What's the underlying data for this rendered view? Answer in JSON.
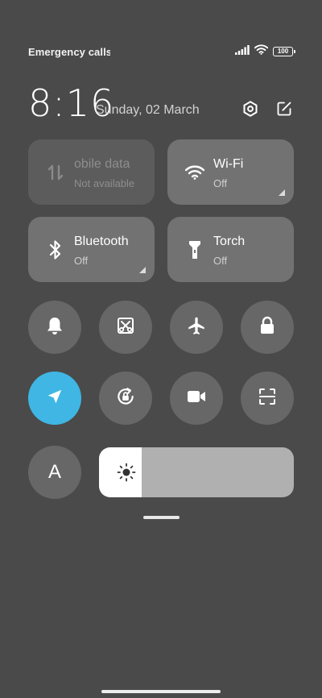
{
  "status_bar": {
    "carrier_text": "Emergency calls o",
    "battery_level": "100",
    "icons": [
      "signal-icon",
      "wifi-icon",
      "battery-icon"
    ]
  },
  "header": {
    "time": "8:16",
    "date": "Sunday, 02 March",
    "icons": [
      "settings-icon",
      "edit-icon"
    ]
  },
  "tiles": [
    {
      "title": "obile data",
      "subtitle": "Not available",
      "icon": "mobile-data-icon",
      "state": "disabled"
    },
    {
      "title": "Wi-Fi",
      "subtitle": "Off",
      "icon": "wifi-icon",
      "state": "off"
    },
    {
      "title": "Bluetooth",
      "subtitle": "Off",
      "icon": "bluetooth-icon",
      "state": "off"
    },
    {
      "title": "Torch",
      "subtitle": "Off",
      "icon": "torch-icon",
      "state": "off"
    }
  ],
  "toggles": [
    {
      "icon": "bell-icon",
      "active": false
    },
    {
      "icon": "screenshot-icon",
      "active": false
    },
    {
      "icon": "airplane-icon",
      "active": false
    },
    {
      "icon": "lock-icon",
      "active": false
    },
    {
      "icon": "location-icon",
      "active": true
    },
    {
      "icon": "rotation-lock-icon",
      "active": false
    },
    {
      "icon": "screen-record-icon",
      "active": false
    },
    {
      "icon": "scanner-icon",
      "active": false
    }
  ],
  "auto_brightness_label": "A",
  "brightness_level": 0.22,
  "colors": {
    "background": "#4a4a4a",
    "tile": "#727272",
    "toggle": "#676767",
    "active_accent": "#3fb6e4",
    "slider_track": "#b0b0b0",
    "slider_fill": "#ffffff"
  }
}
